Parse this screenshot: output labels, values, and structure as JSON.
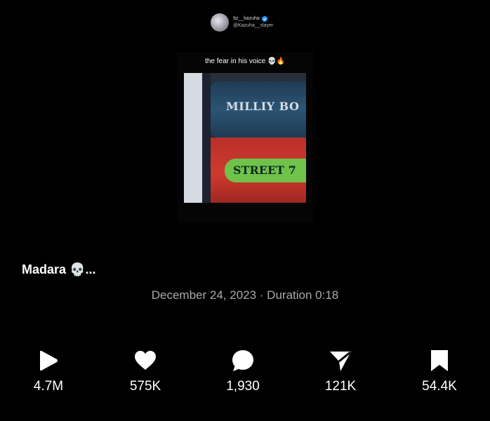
{
  "author": {
    "display_name": "Itz__kazuha",
    "handle": "@Kazuha__slayer",
    "verified": true
  },
  "video": {
    "overlay_caption": "the fear in his voice 💀🔥",
    "sign_top_text": "MILLIY BO",
    "sign_bottom_text": "STREET 7"
  },
  "post": {
    "title": "Madara 💀...",
    "meta": "December 24, 2023 · Duration 0:18"
  },
  "actions": [
    {
      "name": "play",
      "icon": "play-icon",
      "count": "4.7M"
    },
    {
      "name": "like",
      "icon": "heart-icon",
      "count": "575K"
    },
    {
      "name": "comment",
      "icon": "comment-bubble-icon",
      "count": "1,930"
    },
    {
      "name": "share",
      "icon": "send-icon",
      "count": "121K"
    },
    {
      "name": "save",
      "icon": "bookmark-icon",
      "count": "54.4K"
    }
  ],
  "colors": {
    "background": "#000000",
    "text": "#ffffff",
    "meta_text": "#a9a9a9",
    "verified_badge": "#1d9bf0"
  }
}
